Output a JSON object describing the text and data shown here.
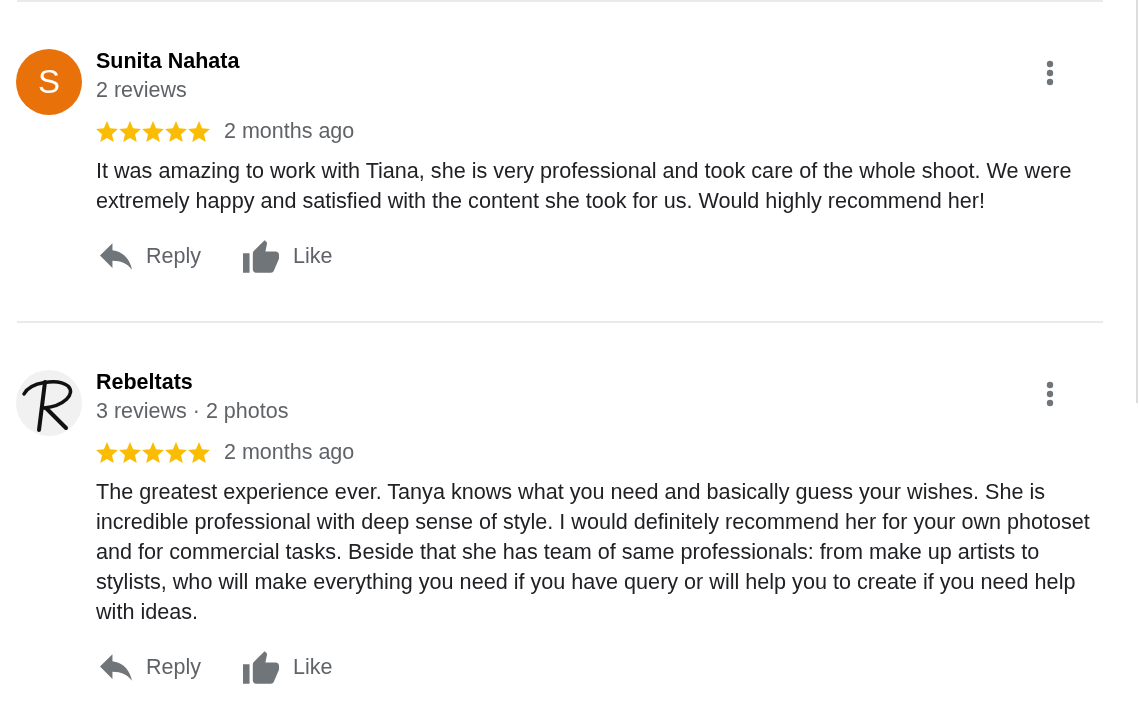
{
  "reviews": [
    {
      "author": "Sunita Nahata",
      "avatar": {
        "kind": "letter",
        "letter": "S",
        "color": "#e8710a"
      },
      "meta": "2 reviews",
      "stars": 5,
      "time": "2 months ago",
      "text": "It was amazing to work with Tiana, she is very professional and took care of the whole shoot. We were extremely happy and satisfied with the content she took for us. Would highly recommend her!",
      "actions": [
        {
          "kind": "reply",
          "label": "Reply"
        },
        {
          "kind": "like",
          "label": "Like"
        }
      ]
    },
    {
      "author": "Rebeltats",
      "avatar": {
        "kind": "image"
      },
      "meta": "3 reviews · 2 photos",
      "stars": 5,
      "time": "2 months ago",
      "text": "The greatest experience ever. Tanya knows what you need and basically guess your wishes. She is incredible professional with deep sense of style. I would definitely recommend her for your own photoset and for commercial tasks. Beside that she has team of same professionals: from make up artists to stylists, who will make everything you need if you have query or will help you to create if you need help with ideas.",
      "actions": [
        {
          "kind": "reply",
          "label": "Reply"
        },
        {
          "kind": "like",
          "label": "Like"
        }
      ]
    }
  ]
}
